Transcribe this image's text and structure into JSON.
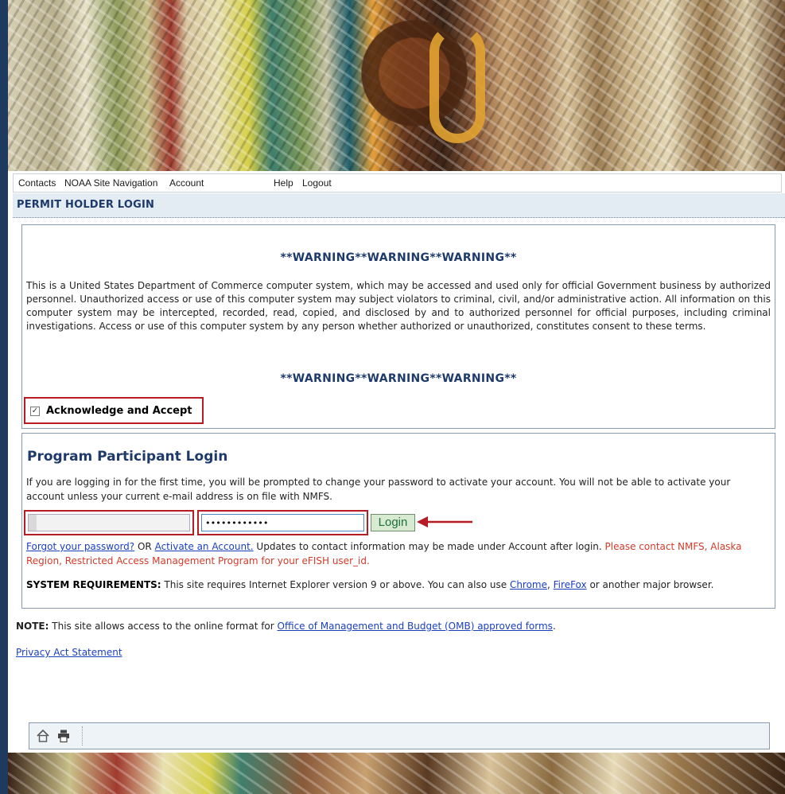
{
  "nav": {
    "items": [
      "Contacts",
      "NOAA Site Navigation",
      "Account",
      "Help",
      "Logout"
    ]
  },
  "page": {
    "title": "PERMIT HOLDER LOGIN"
  },
  "warning": {
    "heading_top": "**WARNING**WARNING**WARNING**",
    "body": "This is a United States Department of Commerce computer system, which may be accessed and used only for official Government business by authorized personnel. Unauthorized access or use of this computer system may subject violators to criminal, civil, and/or administrative action. All information on this computer system may be intercepted, recorded, read, copied, and disclosed by and to authorized personnel for official purposes, including criminal investigations. Access or use of this computer system by any person whether authorized or unauthorized, constitutes consent to these terms.",
    "heading_bottom": "**WARNING**WARNING**WARNING**",
    "ack_label": "Acknowledge and Accept",
    "ack_checked": true
  },
  "login": {
    "title": "Program Participant Login",
    "description": "If you are logging in for the first time, you will be prompted to change your password to activate your account. You will not be able to activate your account unless your current e-mail address is on file with NMFS.",
    "username_value": "",
    "password_value": "••••••••••••",
    "button_label": "Login",
    "forgot_link": "Forgot your password?",
    "or_text": " OR ",
    "activate_link": "Activate an Account.",
    "updates_text": " Updates to contact information may be made under Account after login. ",
    "contact_text": "Please contact NMFS, Alaska Region, Restricted Access Management Program for your eFISH user_id."
  },
  "sysreq": {
    "label": "SYSTEM REQUIREMENTS:",
    "text_before": " This site requires Internet Explorer version 9 or above. You can also use ",
    "chrome_link": "Chrome",
    "comma": ", ",
    "firefox_link": "FireFox",
    "text_after": " or another major browser."
  },
  "note": {
    "label": "NOTE:",
    "text": " This site allows access to the online format for ",
    "link": "Office of Management and Budget (OMB) approved forms",
    "end": "."
  },
  "privacy_link": "Privacy Act Statement",
  "footer": {
    "icons": [
      "home-icon",
      "print-icon"
    ]
  },
  "colors": {
    "brand_blue": "#1e3a6b",
    "highlight_red": "#b51c24",
    "link_blue": "#1a3fbf",
    "contact_red": "#d23b2a"
  }
}
